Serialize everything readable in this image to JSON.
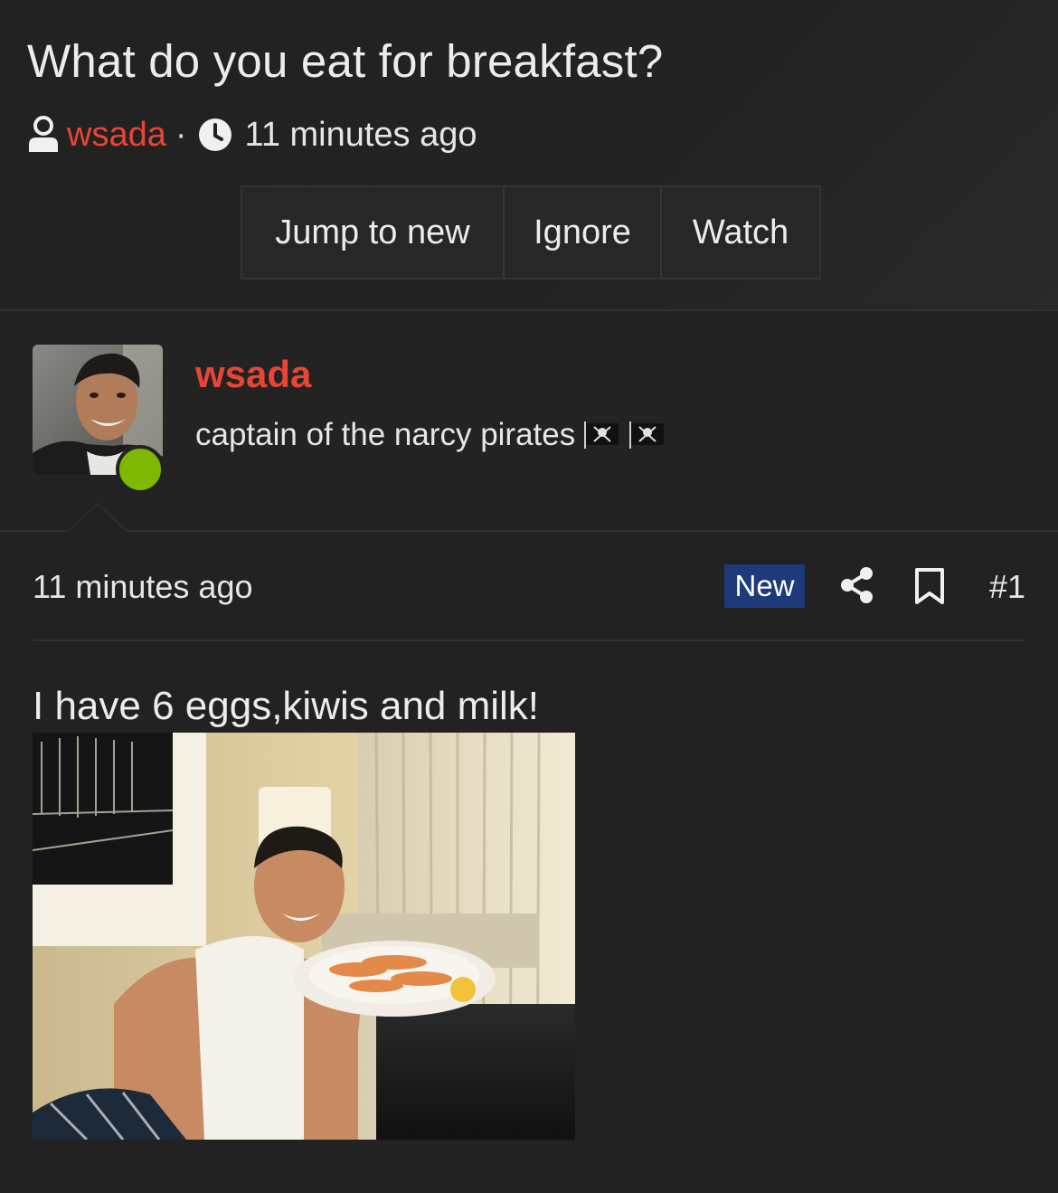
{
  "thread": {
    "title": "What do you eat for breakfast?",
    "author": "wsada",
    "separator": "·",
    "time": "11 minutes ago"
  },
  "actions": {
    "jump_label": "Jump to new",
    "ignore_label": "Ignore",
    "watch_label": "Watch"
  },
  "poster": {
    "name": "wsada",
    "title": "captain of the narcy pirates",
    "online": true,
    "flags": [
      "pirate-flag-icon",
      "pirate-flag-icon"
    ]
  },
  "post": {
    "time": "11 minutes ago",
    "badge": "New",
    "number": "#1",
    "body": "I have 6 eggs,kiwis and milk!"
  },
  "colors": {
    "background": "#222222",
    "accent": "#e84535",
    "badge": "#1e3a7a",
    "online": "#7fb800"
  },
  "icons": {
    "author": "user-icon",
    "time": "clock-icon",
    "share": "share-icon",
    "bookmark": "bookmark-icon"
  }
}
